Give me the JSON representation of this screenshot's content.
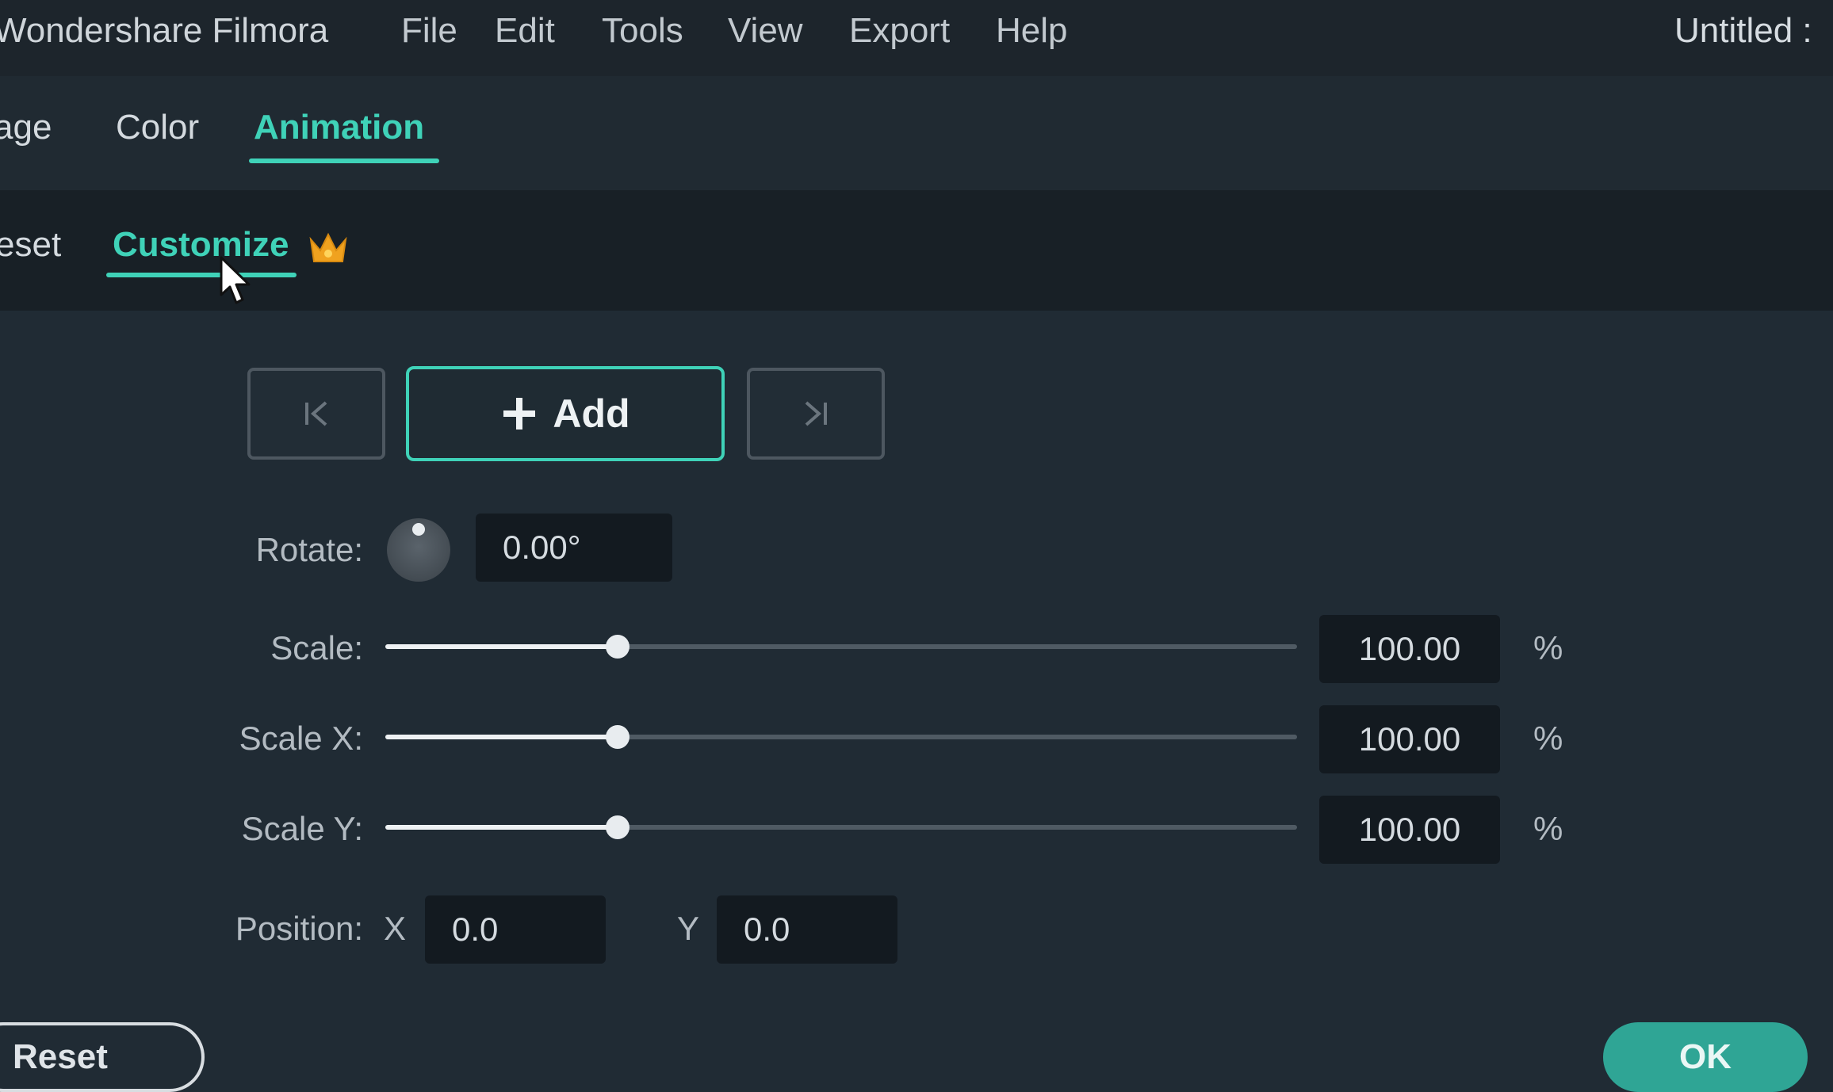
{
  "menubar": {
    "app_title": "Wondershare Filmora",
    "items": [
      "File",
      "Edit",
      "Tools",
      "View",
      "Export",
      "Help"
    ],
    "document_title": "Untitled : "
  },
  "tabs": {
    "items": [
      "age",
      "Color",
      "Animation"
    ],
    "active": "Animation"
  },
  "subtabs": {
    "preset_label": "eset",
    "customize_label": "Customize",
    "premium_icon": "crown-icon"
  },
  "keyframes": {
    "prev_icon": "prev-keyframe-icon",
    "add_label": "Add",
    "next_icon": "next-keyframe-icon"
  },
  "rotate": {
    "label": "Rotate:",
    "value": "0.00°"
  },
  "scale": {
    "label": "Scale:",
    "value": "100.00",
    "unit": "%",
    "level": 0.255
  },
  "scale_x": {
    "label": "Scale X:",
    "value": "100.00",
    "unit": "%",
    "level": 0.255
  },
  "scale_y": {
    "label": "Scale Y:",
    "value": "100.00",
    "unit": "%",
    "level": 0.255
  },
  "position": {
    "label": "Position:",
    "x_label": "X",
    "x_value": "0.0",
    "y_label": "Y",
    "y_value": "0.0"
  },
  "footer": {
    "reset_label": "Reset",
    "ok_label": "OK"
  },
  "colors": {
    "accent": "#3fd2b8",
    "ok": "#2fa595"
  }
}
